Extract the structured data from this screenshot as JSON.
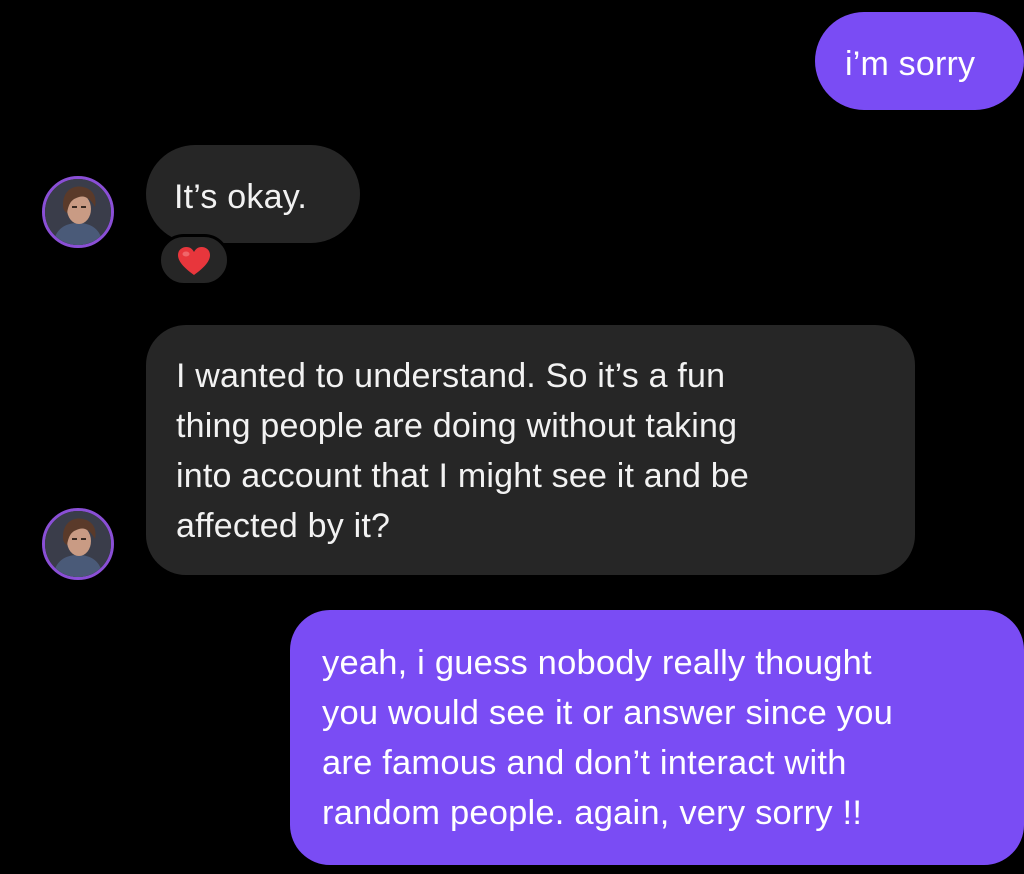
{
  "conversation": {
    "messages": [
      {
        "sender": "self",
        "text": "i’m sorry"
      },
      {
        "sender": "other",
        "text": "It’s okay."
      },
      {
        "sender": "other",
        "text": "I wanted to understand. So it’s a fun\nthing people are doing without taking\ninto account that I might see it and be\naffected by it?"
      },
      {
        "sender": "self",
        "text": "yeah, i guess nobody really thought\nyou would see it or answer since you\nare famous and don’t interact with\nrandom people. again, very sorry !!"
      }
    ],
    "reactions": [
      {
        "on_message": 1,
        "icon": "heart-icon",
        "color": "#e8363c"
      }
    ],
    "avatar": {
      "icon": "profile-photo",
      "ring_color": "#8a4fd6"
    }
  },
  "colors": {
    "background": "#000000",
    "incoming_bubble": "#262626",
    "outgoing_bubble": "#7a4cf4",
    "text": "#f2f2f2"
  }
}
